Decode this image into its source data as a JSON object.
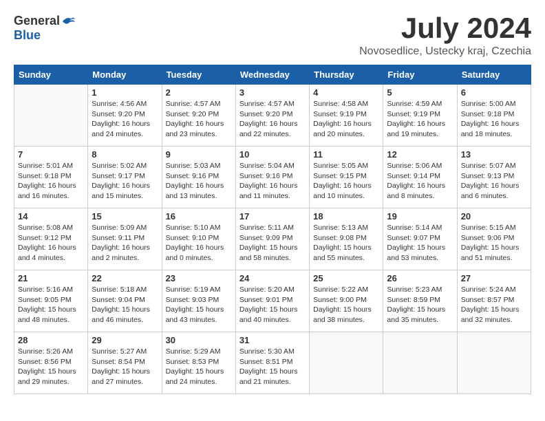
{
  "header": {
    "logo_general": "General",
    "logo_blue": "Blue",
    "month_title": "July 2024",
    "location": "Novosedlice, Ustecky kraj, Czechia"
  },
  "days_of_week": [
    "Sunday",
    "Monday",
    "Tuesday",
    "Wednesday",
    "Thursday",
    "Friday",
    "Saturday"
  ],
  "weeks": [
    [
      {
        "day": "",
        "info": ""
      },
      {
        "day": "1",
        "info": "Sunrise: 4:56 AM\nSunset: 9:20 PM\nDaylight: 16 hours\nand 24 minutes."
      },
      {
        "day": "2",
        "info": "Sunrise: 4:57 AM\nSunset: 9:20 PM\nDaylight: 16 hours\nand 23 minutes."
      },
      {
        "day": "3",
        "info": "Sunrise: 4:57 AM\nSunset: 9:20 PM\nDaylight: 16 hours\nand 22 minutes."
      },
      {
        "day": "4",
        "info": "Sunrise: 4:58 AM\nSunset: 9:19 PM\nDaylight: 16 hours\nand 20 minutes."
      },
      {
        "day": "5",
        "info": "Sunrise: 4:59 AM\nSunset: 9:19 PM\nDaylight: 16 hours\nand 19 minutes."
      },
      {
        "day": "6",
        "info": "Sunrise: 5:00 AM\nSunset: 9:18 PM\nDaylight: 16 hours\nand 18 minutes."
      }
    ],
    [
      {
        "day": "7",
        "info": "Sunrise: 5:01 AM\nSunset: 9:18 PM\nDaylight: 16 hours\nand 16 minutes."
      },
      {
        "day": "8",
        "info": "Sunrise: 5:02 AM\nSunset: 9:17 PM\nDaylight: 16 hours\nand 15 minutes."
      },
      {
        "day": "9",
        "info": "Sunrise: 5:03 AM\nSunset: 9:16 PM\nDaylight: 16 hours\nand 13 minutes."
      },
      {
        "day": "10",
        "info": "Sunrise: 5:04 AM\nSunset: 9:16 PM\nDaylight: 16 hours\nand 11 minutes."
      },
      {
        "day": "11",
        "info": "Sunrise: 5:05 AM\nSunset: 9:15 PM\nDaylight: 16 hours\nand 10 minutes."
      },
      {
        "day": "12",
        "info": "Sunrise: 5:06 AM\nSunset: 9:14 PM\nDaylight: 16 hours\nand 8 minutes."
      },
      {
        "day": "13",
        "info": "Sunrise: 5:07 AM\nSunset: 9:13 PM\nDaylight: 16 hours\nand 6 minutes."
      }
    ],
    [
      {
        "day": "14",
        "info": "Sunrise: 5:08 AM\nSunset: 9:12 PM\nDaylight: 16 hours\nand 4 minutes."
      },
      {
        "day": "15",
        "info": "Sunrise: 5:09 AM\nSunset: 9:11 PM\nDaylight: 16 hours\nand 2 minutes."
      },
      {
        "day": "16",
        "info": "Sunrise: 5:10 AM\nSunset: 9:10 PM\nDaylight: 16 hours\nand 0 minutes."
      },
      {
        "day": "17",
        "info": "Sunrise: 5:11 AM\nSunset: 9:09 PM\nDaylight: 15 hours\nand 58 minutes."
      },
      {
        "day": "18",
        "info": "Sunrise: 5:13 AM\nSunset: 9:08 PM\nDaylight: 15 hours\nand 55 minutes."
      },
      {
        "day": "19",
        "info": "Sunrise: 5:14 AM\nSunset: 9:07 PM\nDaylight: 15 hours\nand 53 minutes."
      },
      {
        "day": "20",
        "info": "Sunrise: 5:15 AM\nSunset: 9:06 PM\nDaylight: 15 hours\nand 51 minutes."
      }
    ],
    [
      {
        "day": "21",
        "info": "Sunrise: 5:16 AM\nSunset: 9:05 PM\nDaylight: 15 hours\nand 48 minutes."
      },
      {
        "day": "22",
        "info": "Sunrise: 5:18 AM\nSunset: 9:04 PM\nDaylight: 15 hours\nand 46 minutes."
      },
      {
        "day": "23",
        "info": "Sunrise: 5:19 AM\nSunset: 9:03 PM\nDaylight: 15 hours\nand 43 minutes."
      },
      {
        "day": "24",
        "info": "Sunrise: 5:20 AM\nSunset: 9:01 PM\nDaylight: 15 hours\nand 40 minutes."
      },
      {
        "day": "25",
        "info": "Sunrise: 5:22 AM\nSunset: 9:00 PM\nDaylight: 15 hours\nand 38 minutes."
      },
      {
        "day": "26",
        "info": "Sunrise: 5:23 AM\nSunset: 8:59 PM\nDaylight: 15 hours\nand 35 minutes."
      },
      {
        "day": "27",
        "info": "Sunrise: 5:24 AM\nSunset: 8:57 PM\nDaylight: 15 hours\nand 32 minutes."
      }
    ],
    [
      {
        "day": "28",
        "info": "Sunrise: 5:26 AM\nSunset: 8:56 PM\nDaylight: 15 hours\nand 29 minutes."
      },
      {
        "day": "29",
        "info": "Sunrise: 5:27 AM\nSunset: 8:54 PM\nDaylight: 15 hours\nand 27 minutes."
      },
      {
        "day": "30",
        "info": "Sunrise: 5:29 AM\nSunset: 8:53 PM\nDaylight: 15 hours\nand 24 minutes."
      },
      {
        "day": "31",
        "info": "Sunrise: 5:30 AM\nSunset: 8:51 PM\nDaylight: 15 hours\nand 21 minutes."
      },
      {
        "day": "",
        "info": ""
      },
      {
        "day": "",
        "info": ""
      },
      {
        "day": "",
        "info": ""
      }
    ]
  ]
}
